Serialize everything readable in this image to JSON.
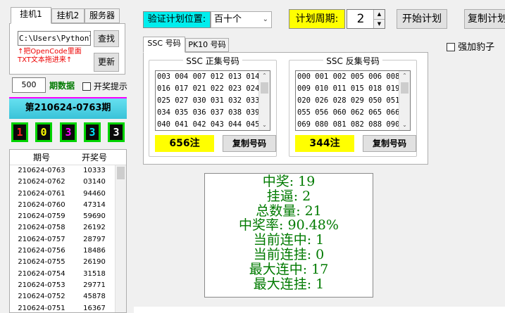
{
  "tabs": [
    {
      "label": "挂机1"
    },
    {
      "label": "挂机2"
    },
    {
      "label": "服务器"
    }
  ],
  "path": {
    "value": "C:\\Users\\Python\\D"
  },
  "find_button": "查找",
  "hint": [
    "↑把OpenCode里面",
    "TXT文本拖进来↑"
  ],
  "update_button": "更新",
  "period_count": {
    "value": "500",
    "label": "期数据"
  },
  "prize_hint": "开奖提示",
  "current_period": "第210624-0763期",
  "balls": [
    {
      "digit": "1",
      "color": "#ff2020"
    },
    {
      "digit": "0",
      "color": "#ffff00"
    },
    {
      "digit": "3",
      "color": "#ff00ff"
    },
    {
      "digit": "3",
      "color": "#00e5ff"
    },
    {
      "digit": "3",
      "color": "#ffffff"
    }
  ],
  "table": {
    "headers": [
      "期号",
      "开奖号"
    ],
    "rows": [
      [
        "210624-0763",
        "10333"
      ],
      [
        "210624-0762",
        "03140"
      ],
      [
        "210624-0761",
        "94460"
      ],
      [
        "210624-0760",
        "47314"
      ],
      [
        "210624-0759",
        "59690"
      ],
      [
        "210624-0758",
        "26192"
      ],
      [
        "210624-0757",
        "28797"
      ],
      [
        "210624-0756",
        "18486"
      ],
      [
        "210624-0755",
        "26190"
      ],
      [
        "210624-0754",
        "31518"
      ],
      [
        "210624-0753",
        "29771"
      ],
      [
        "210624-0752",
        "45878"
      ],
      [
        "210624-0751",
        "16367"
      ]
    ]
  },
  "plan_position": {
    "label": "验证计划位置:",
    "value": "百十个"
  },
  "plan_cycle": {
    "label": "计划周期:",
    "value": "2"
  },
  "start_button": "开始计划",
  "copy_button": "复制计划",
  "force_leopard": "强加豹子",
  "sub_tabs": [
    {
      "label": "SSC 号码"
    },
    {
      "label": "PK10 号码"
    }
  ],
  "forward": {
    "title": "SSC 正集号码",
    "lines": [
      "003 004 007 012 013 014",
      "016 017 021 022 023 024",
      "025 027 030 031 032 033",
      "034 035 036 037 038 039",
      "040 041 042 043 044 045"
    ],
    "count": "656注",
    "copy": "复制号码"
  },
  "reverse": {
    "title": "SSC 反集号码",
    "lines": [
      "000 001 002 005 006 008",
      "009 010 011 015 018 019",
      "020 026 028 029 050 051",
      "055 056 060 062 065 066",
      "069 080 081 082 088 090"
    ],
    "count": "344注",
    "copy": "复制号码"
  },
  "stats": [
    "中奖: 19",
    "挂逼: 2",
    "总数量: 21",
    "中奖率: 90.48%",
    "当前连中: 1",
    "当前连挂: 0",
    "最大连中: 17",
    "最大连挂: 1"
  ]
}
